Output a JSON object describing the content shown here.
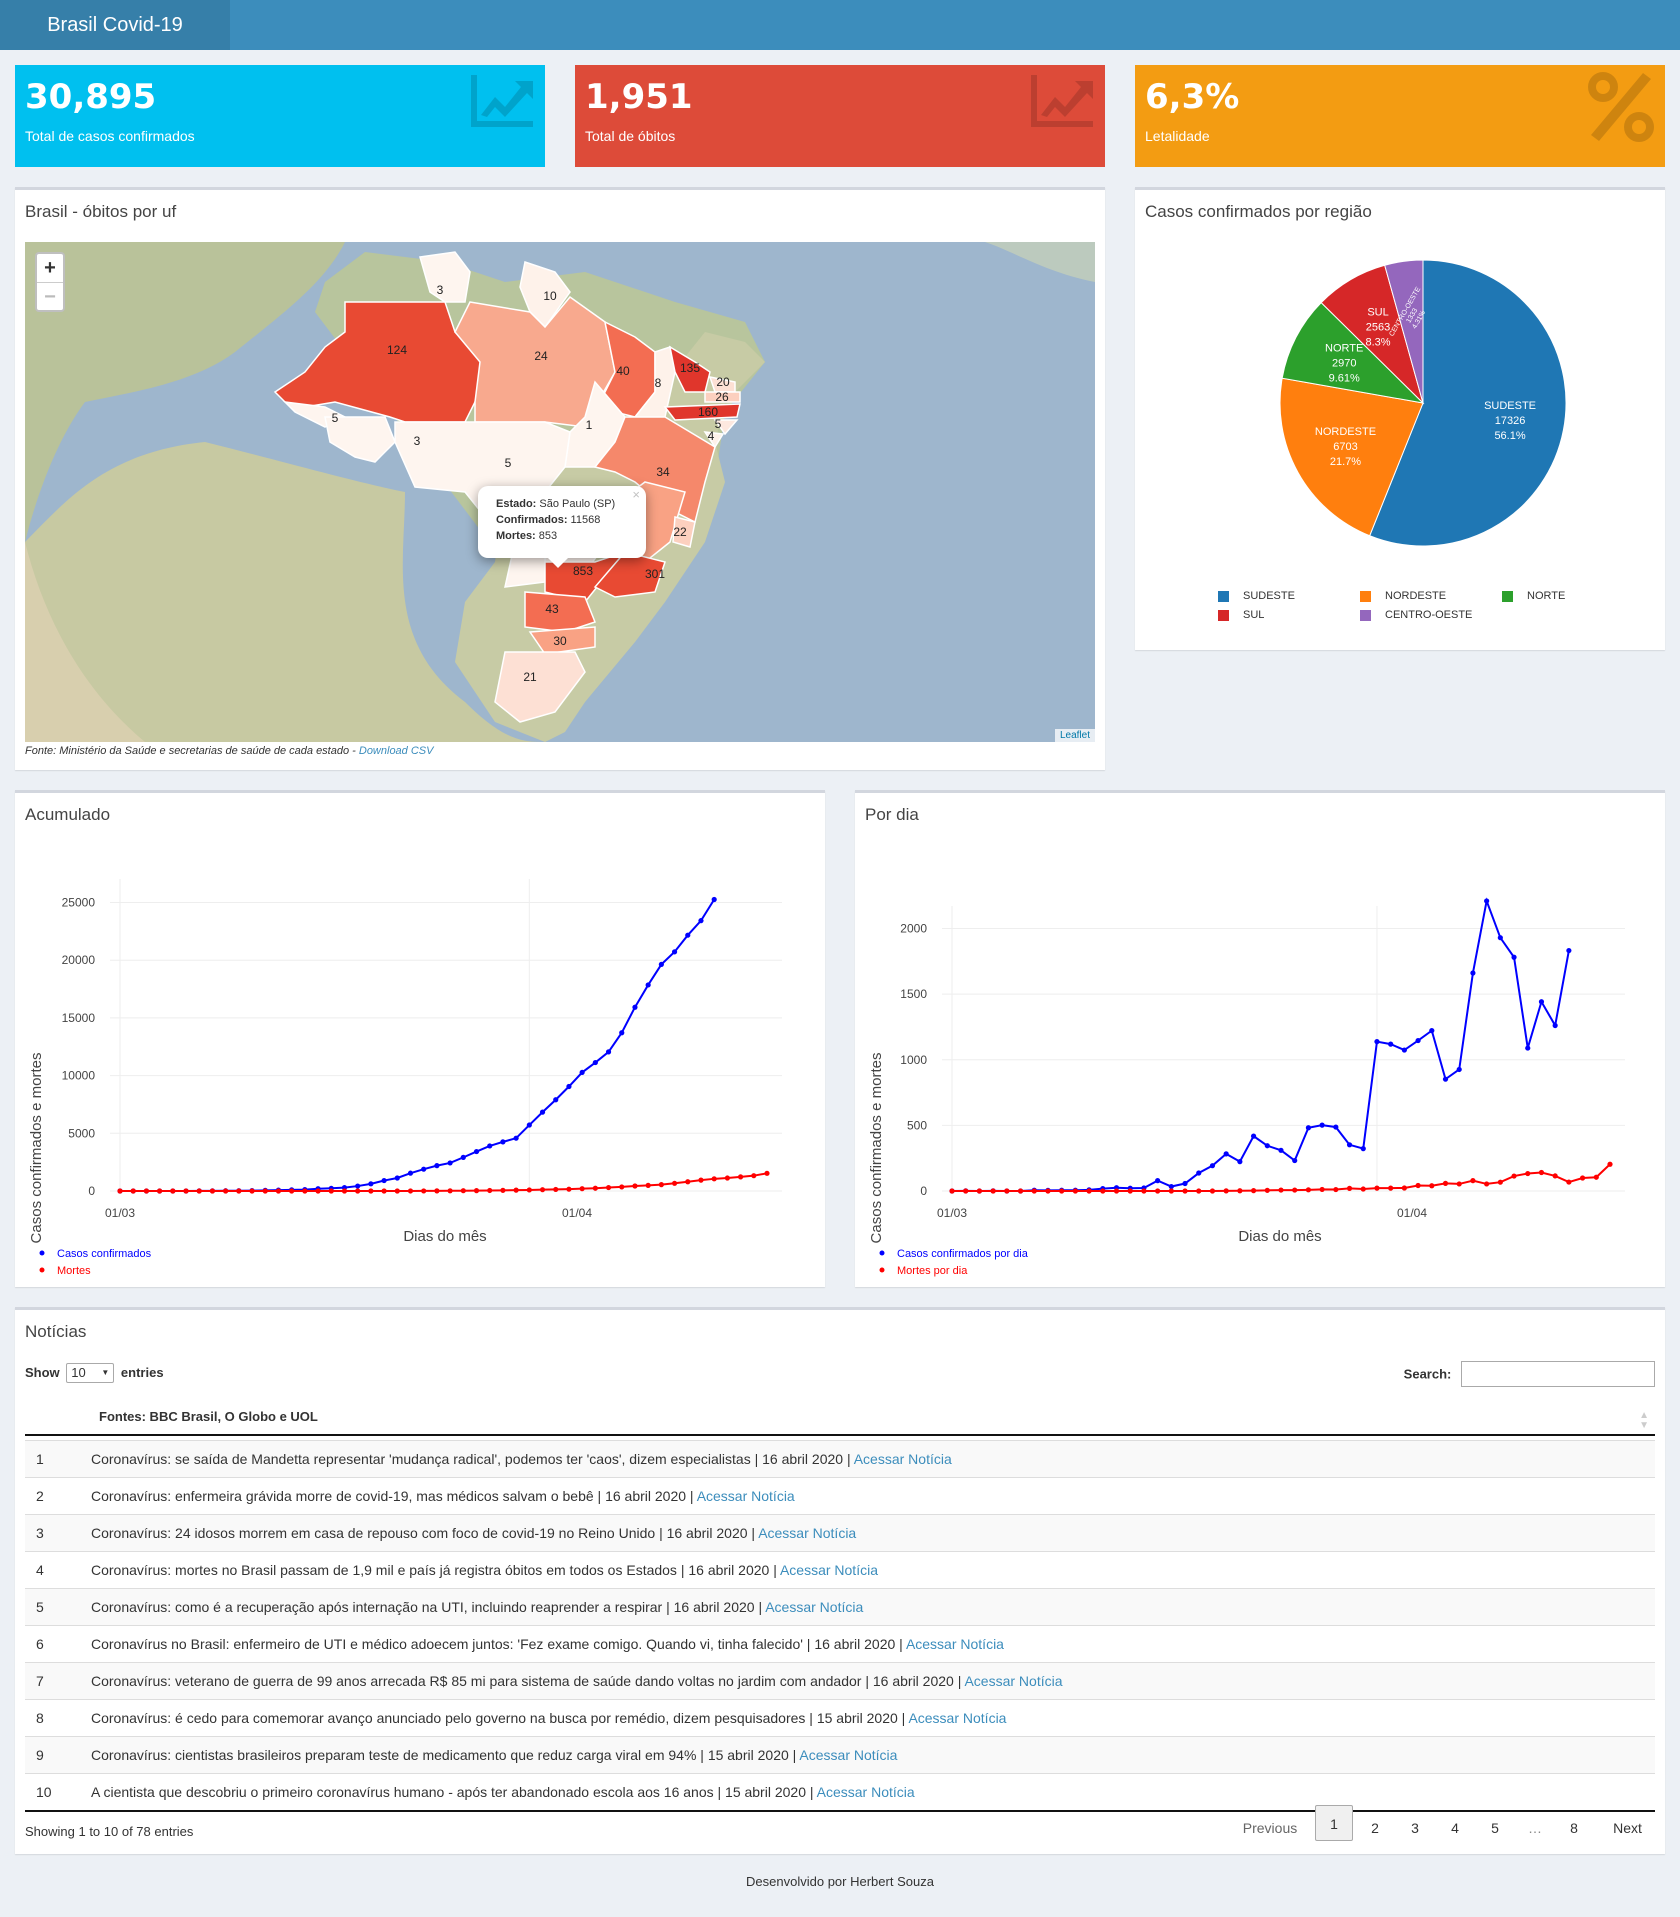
{
  "header": {
    "brand": "Brasil Covid-19"
  },
  "stats": [
    {
      "value": "30,895",
      "label": "Total de casos confirmados",
      "color": "#00c0ef",
      "icon": "trend-chart-icon"
    },
    {
      "value": "1,951",
      "label": "Total de óbitos",
      "color": "#dd4b39",
      "icon": "trend-chart-icon"
    },
    {
      "value": "6,3%",
      "label": "Letalidade",
      "color": "#f39c12",
      "icon": "percent-icon"
    }
  ],
  "map": {
    "title": "Brasil - óbitos por uf",
    "zoom_in": "+",
    "zoom_out": "−",
    "states": [
      {
        "name": "AM",
        "deaths": "124"
      },
      {
        "name": "RR",
        "deaths": "3"
      },
      {
        "name": "AP",
        "deaths": "10"
      },
      {
        "name": "PA",
        "deaths": "24"
      },
      {
        "name": "MA",
        "deaths": "40"
      },
      {
        "name": "PI",
        "deaths": "8"
      },
      {
        "name": "CE",
        "deaths": "135"
      },
      {
        "name": "RN",
        "deaths": "20"
      },
      {
        "name": "PB",
        "deaths": "26"
      },
      {
        "name": "PE",
        "deaths": "160"
      },
      {
        "name": "AL",
        "deaths": "5"
      },
      {
        "name": "SE",
        "deaths": "4"
      },
      {
        "name": "AC",
        "deaths": "5"
      },
      {
        "name": "RO",
        "deaths": "3"
      },
      {
        "name": "TO",
        "deaths": "1"
      },
      {
        "name": "MT",
        "deaths": "5"
      },
      {
        "name": "BA",
        "deaths": "34"
      },
      {
        "name": "ES",
        "deaths": "22"
      },
      {
        "name": "SP",
        "deaths": "853"
      },
      {
        "name": "RJ",
        "deaths": "301"
      },
      {
        "name": "PR",
        "deaths": "43"
      },
      {
        "name": "SC",
        "deaths": "30"
      },
      {
        "name": "RS",
        "deaths": "21"
      }
    ],
    "popup": {
      "l1": "Estado:",
      "v1": " São Paulo (SP)",
      "l2": "Confirmados:",
      "v2": " 11568",
      "l3": "Mortes:",
      "v3": " 853",
      "close": "×"
    },
    "attribution": "Leaflet",
    "source": "Fonte: Ministério da Saúde e secretarias de saúde de cada estado - ",
    "source_link": "Download CSV"
  },
  "pie": {
    "title": "Casos confirmados por região",
    "legend": [
      "SUDESTE",
      "NORDESTE",
      "NORTE",
      "SUL",
      "CENTRO-OESTE"
    ]
  },
  "chart_data": [
    {
      "type": "pie",
      "title": "Casos confirmados por região",
      "labels": [
        "SUDESTE",
        "NORDESTE",
        "NORTE",
        "SUL",
        "CENTRO-OESTE"
      ],
      "values": [
        17326,
        6703,
        2970,
        2563,
        1333
      ],
      "percents": [
        "56.1%",
        "21.7%",
        "9.61%",
        "8.3%",
        "4.31%"
      ],
      "colors": [
        "#1f77b4",
        "#ff7f0e",
        "#2ca02c",
        "#d62728",
        "#9467bd"
      ]
    },
    {
      "type": "line",
      "title": "Acumulado",
      "xlabel": "Dias do mês",
      "ylabel": "Casos confirmados e mortes",
      "x_ticks": [
        "01/03",
        "01/04"
      ],
      "ylim": [
        0,
        25000
      ],
      "series": [
        {
          "name": "Casos confirmados",
          "color": "#0000ff",
          "values": [
            0,
            1,
            1,
            2,
            2,
            2,
            8,
            13,
            19,
            25,
            34,
            52,
            77,
            98,
            121,
            200,
            234,
            291,
            428,
            621,
            904,
            1128,
            1546,
            1891,
            2201,
            2433,
            2915,
            3417,
            3904,
            4256,
            4579,
            5717,
            6836,
            7910,
            9056,
            10278,
            11130,
            12056,
            13717,
            15927,
            17857,
            19638,
            20727,
            22169,
            23430,
            25262
          ]
        },
        {
          "name": "Mortes",
          "color": "#ff0000",
          "values": [
            0,
            0,
            0,
            0,
            0,
            0,
            0,
            0,
            0,
            0,
            0,
            0,
            0,
            0,
            0,
            0,
            0,
            0,
            0,
            0,
            0,
            1,
            3,
            6,
            11,
            18,
            25,
            34,
            46,
            57,
            77,
            92,
            114,
            136,
            159,
            201,
            241,
            299,
            353,
            432,
            486,
            553,
            667,
            800,
            941,
            1056,
            1124,
            1223,
            1328,
            1532
          ]
        }
      ]
    },
    {
      "type": "line",
      "title": "Por dia",
      "xlabel": "Dias do mês",
      "ylabel": "Casos confirmados e mortes",
      "x_ticks": [
        "01/03",
        "01/04"
      ],
      "ylim": [
        0,
        2000
      ],
      "series": [
        {
          "name": "Casos confirmados por dia",
          "color": "#0000ff",
          "values": [
            0,
            1,
            0,
            1,
            0,
            0,
            6,
            5,
            6,
            6,
            9,
            18,
            25,
            21,
            23,
            79,
            34,
            57,
            137,
            193,
            283,
            224,
            418,
            345,
            310,
            232,
            482,
            502,
            487,
            352,
            323,
            1138,
            1119,
            1074,
            1146,
            1222,
            852,
            926,
            1661,
            2210,
            1930,
            1781,
            1089,
            1442,
            1261,
            1832
          ]
        },
        {
          "name": "Mortes por dia",
          "color": "#ff0000",
          "values": [
            0,
            0,
            0,
            0,
            0,
            0,
            0,
            0,
            0,
            0,
            0,
            0,
            0,
            0,
            0,
            0,
            0,
            0,
            0,
            0,
            1,
            2,
            3,
            5,
            7,
            7,
            9,
            12,
            11,
            20,
            15,
            22,
            22,
            23,
            42,
            40,
            58,
            54,
            79,
            54,
            67,
            114,
            133,
            141,
            115,
            68,
            99,
            105,
            204
          ]
        }
      ]
    }
  ],
  "acc": {
    "title": "Acumulado",
    "ylabel": "Casos confirmados e mortes",
    "xlabel": "Dias do mês",
    "x1": "01/03",
    "x2": "01/04",
    "yticks": [
      "0",
      "5000",
      "10000",
      "15000",
      "20000",
      "25000"
    ],
    "leg1": "Casos confirmados",
    "leg2": "Mortes"
  },
  "daily": {
    "title": "Por dia",
    "ylabel": "Casos confirmados e mortes",
    "xlabel": "Dias do mês",
    "x1": "01/03",
    "x2": "01/04",
    "yticks": [
      "0",
      "500",
      "1000",
      "1500",
      "2000"
    ],
    "leg1": "Casos confirmados por dia",
    "leg2": "Mortes por dia"
  },
  "news": {
    "title": "Notícias",
    "show": "Show",
    "entries_value": "10",
    "entries": "entries",
    "search": "Search:",
    "column": "Fontes: BBC Brasil, O Globo e UOL",
    "rows": [
      {
        "n": "1",
        "text": "Coronavírus: se saída de Mandetta representar 'mudança radical', podemos ter 'caos', dizem especialistas | 16 abril 2020 | ",
        "link": "Acessar Notícia"
      },
      {
        "n": "2",
        "text": "Coronavírus: enfermeira grávida morre de covid-19, mas médicos salvam o bebê | 16 abril 2020 | ",
        "link": "Acessar Notícia"
      },
      {
        "n": "3",
        "text": "Coronavírus: 24 idosos morrem em casa de repouso com foco de covid-19 no Reino Unido | 16 abril 2020 | ",
        "link": "Acessar Notícia"
      },
      {
        "n": "4",
        "text": "Coronavírus: mortes no Brasil passam de 1,9 mil e país já registra óbitos em todos os Estados | 16 abril 2020 | ",
        "link": "Acessar Notícia"
      },
      {
        "n": "5",
        "text": "Coronavírus: como é a recuperação após internação na UTI, incluindo reaprender a respirar | 16 abril 2020 | ",
        "link": "Acessar Notícia"
      },
      {
        "n": "6",
        "text": "Coronavírus no Brasil: enfermeiro de UTI e médico adoecem juntos: 'Fez exame comigo. Quando vi, tinha falecido' | 16 abril 2020 | ",
        "link": "Acessar Notícia"
      },
      {
        "n": "7",
        "text": "Coronavírus: veterano de guerra de 99 anos arrecada R$ 85 mi para sistema de saúde dando voltas no jardim com andador | 16 abril 2020 | ",
        "link": "Acessar Notícia"
      },
      {
        "n": "8",
        "text": "Coronavírus: é cedo para comemorar avanço anunciado pelo governo na busca por remédio, dizem pesquisadores | 15 abril 2020 | ",
        "link": "Acessar Notícia"
      },
      {
        "n": "9",
        "text": "Coronavírus: cientistas brasileiros preparam teste de medicamento que reduz carga viral em 94% | 15 abril 2020 | ",
        "link": "Acessar Notícia"
      },
      {
        "n": "10",
        "text": "A cientista que descobriu o primeiro coronavírus humano - após ter abandonado escola aos 16 anos | 15 abril 2020 | ",
        "link": "Acessar Notícia"
      }
    ],
    "info": "Showing 1 to 10 of 78 entries",
    "pagination": {
      "prev": "Previous",
      "pages": [
        "1",
        "2",
        "3",
        "4",
        "5",
        "…",
        "8"
      ],
      "next": "Next"
    }
  },
  "footer": "Desenvolvido por Herbert Souza"
}
